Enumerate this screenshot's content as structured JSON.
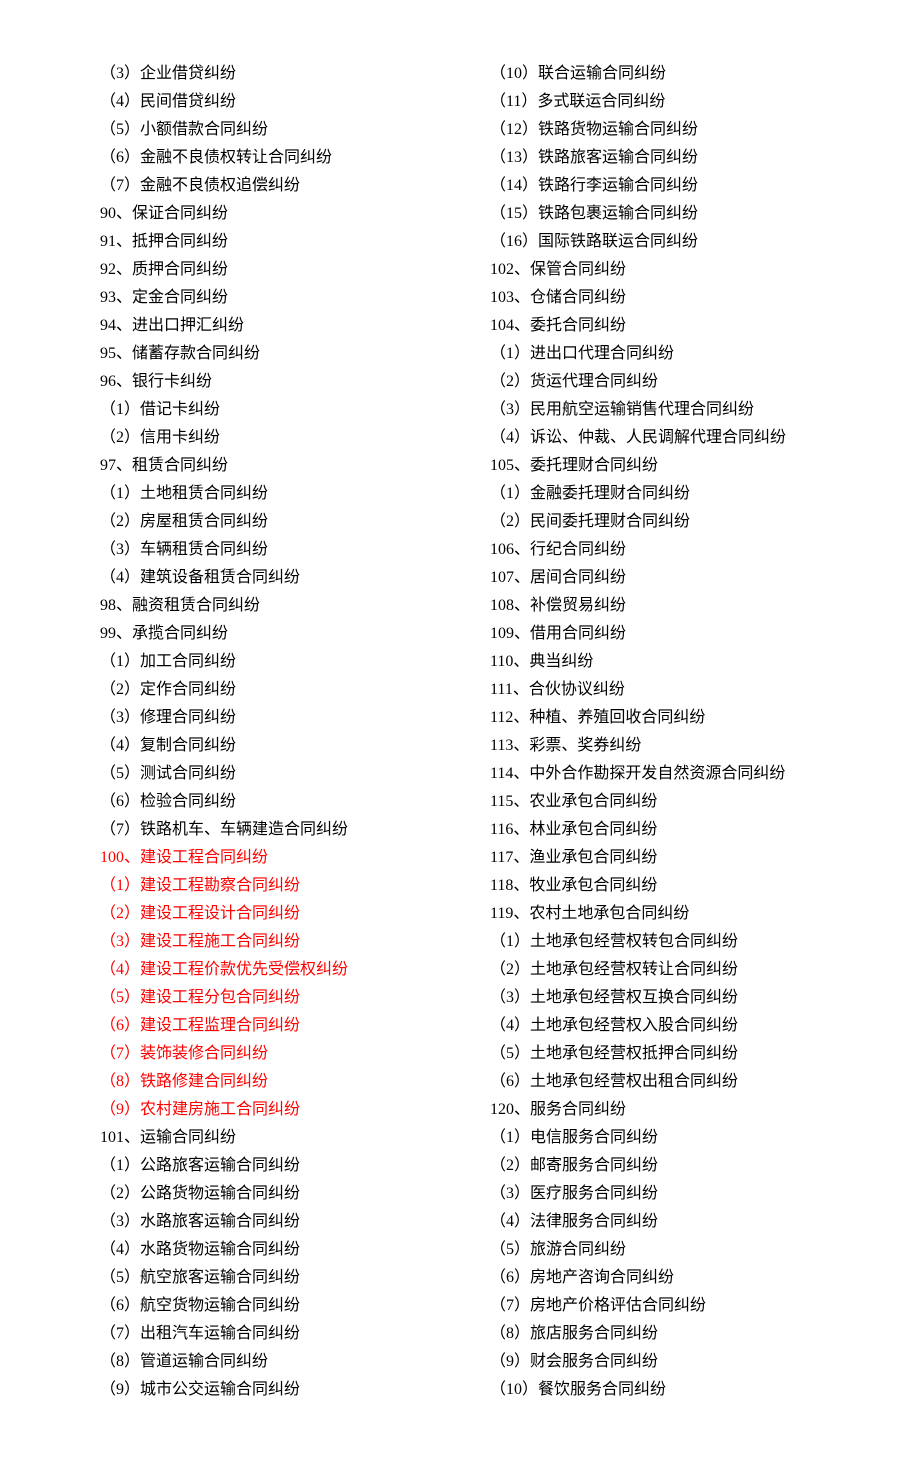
{
  "left": [
    {
      "text": "（3）企业借贷纠纷",
      "red": false
    },
    {
      "text": "（4）民间借贷纠纷",
      "red": false
    },
    {
      "text": "（5）小额借款合同纠纷",
      "red": false
    },
    {
      "text": "（6）金融不良债权转让合同纠纷",
      "red": false
    },
    {
      "text": "（7）金融不良债权追偿纠纷",
      "red": false
    },
    {
      "text": "90、保证合同纠纷",
      "red": false
    },
    {
      "text": "91、抵押合同纠纷",
      "red": false
    },
    {
      "text": "92、质押合同纠纷",
      "red": false
    },
    {
      "text": "93、定金合同纠纷",
      "red": false
    },
    {
      "text": "94、进出口押汇纠纷",
      "red": false
    },
    {
      "text": "95、储蓄存款合同纠纷",
      "red": false
    },
    {
      "text": "96、银行卡纠纷",
      "red": false
    },
    {
      "text": "（1）借记卡纠纷",
      "red": false
    },
    {
      "text": "（2）信用卡纠纷",
      "red": false
    },
    {
      "text": "97、租赁合同纠纷",
      "red": false
    },
    {
      "text": "（1）土地租赁合同纠纷",
      "red": false
    },
    {
      "text": "（2）房屋租赁合同纠纷",
      "red": false
    },
    {
      "text": "（3）车辆租赁合同纠纷",
      "red": false
    },
    {
      "text": "（4）建筑设备租赁合同纠纷",
      "red": false
    },
    {
      "text": "98、融资租赁合同纠纷",
      "red": false
    },
    {
      "text": "99、承揽合同纠纷",
      "red": false
    },
    {
      "text": "（1）加工合同纠纷",
      "red": false
    },
    {
      "text": "（2）定作合同纠纷",
      "red": false
    },
    {
      "text": "（3）修理合同纠纷",
      "red": false
    },
    {
      "text": "（4）复制合同纠纷",
      "red": false
    },
    {
      "text": "（5）测试合同纠纷",
      "red": false
    },
    {
      "text": "（6）检验合同纠纷",
      "red": false
    },
    {
      "text": "（7）铁路机车、车辆建造合同纠纷",
      "red": false
    },
    {
      "text": "100、建设工程合同纠纷",
      "red": true
    },
    {
      "text": "（1）建设工程勘察合同纠纷",
      "red": true
    },
    {
      "text": "（2）建设工程设计合同纠纷",
      "red": true
    },
    {
      "text": "（3）建设工程施工合同纠纷",
      "red": true
    },
    {
      "text": "（4）建设工程价款优先受偿权纠纷",
      "red": true
    },
    {
      "text": "（5）建设工程分包合同纠纷",
      "red": true
    },
    {
      "text": "（6）建设工程监理合同纠纷",
      "red": true
    },
    {
      "text": "（7）装饰装修合同纠纷",
      "red": true
    },
    {
      "text": "（8）铁路修建合同纠纷",
      "red": true
    },
    {
      "text": "（9）农村建房施工合同纠纷",
      "red": true
    },
    {
      "text": "101、运输合同纠纷",
      "red": false
    },
    {
      "text": "（1）公路旅客运输合同纠纷",
      "red": false
    },
    {
      "text": "（2）公路货物运输合同纠纷",
      "red": false
    },
    {
      "text": "（3）水路旅客运输合同纠纷",
      "red": false
    },
    {
      "text": "（4）水路货物运输合同纠纷",
      "red": false
    },
    {
      "text": "（5）航空旅客运输合同纠纷",
      "red": false
    },
    {
      "text": "（6）航空货物运输合同纠纷",
      "red": false
    },
    {
      "text": "（7）出租汽车运输合同纠纷",
      "red": false
    },
    {
      "text": "（8）管道运输合同纠纷",
      "red": false
    },
    {
      "text": "（9）城市公交运输合同纠纷",
      "red": false
    }
  ],
  "right": [
    {
      "text": "（10）联合运输合同纠纷",
      "red": false
    },
    {
      "text": "（11）多式联运合同纠纷",
      "red": false
    },
    {
      "text": "（12）铁路货物运输合同纠纷",
      "red": false
    },
    {
      "text": "（13）铁路旅客运输合同纠纷",
      "red": false
    },
    {
      "text": "（14）铁路行李运输合同纠纷",
      "red": false
    },
    {
      "text": "（15）铁路包裹运输合同纠纷",
      "red": false
    },
    {
      "text": "（16）国际铁路联运合同纠纷",
      "red": false
    },
    {
      "text": "102、保管合同纠纷",
      "red": false
    },
    {
      "text": "103、仓储合同纠纷",
      "red": false
    },
    {
      "text": "104、委托合同纠纷",
      "red": false
    },
    {
      "text": "（1）进出口代理合同纠纷",
      "red": false
    },
    {
      "text": "（2）货运代理合同纠纷",
      "red": false
    },
    {
      "text": "（3）民用航空运输销售代理合同纠纷",
      "red": false
    },
    {
      "text": "（4）诉讼、仲裁、人民调解代理合同纠纷",
      "red": false
    },
    {
      "text": "105、委托理财合同纠纷",
      "red": false
    },
    {
      "text": "（1）金融委托理财合同纠纷",
      "red": false
    },
    {
      "text": "（2）民间委托理财合同纠纷",
      "red": false
    },
    {
      "text": "106、行纪合同纠纷",
      "red": false
    },
    {
      "text": "107、居间合同纠纷",
      "red": false
    },
    {
      "text": "108、补偿贸易纠纷",
      "red": false
    },
    {
      "text": "109、借用合同纠纷",
      "red": false
    },
    {
      "text": "110、典当纠纷",
      "red": false
    },
    {
      "text": "111、合伙协议纠纷",
      "red": false
    },
    {
      "text": "112、种植、养殖回收合同纠纷",
      "red": false
    },
    {
      "text": "113、彩票、奖券纠纷",
      "red": false
    },
    {
      "text": "114、中外合作勘探开发自然资源合同纠纷",
      "red": false
    },
    {
      "text": "115、农业承包合同纠纷",
      "red": false
    },
    {
      "text": "116、林业承包合同纠纷",
      "red": false
    },
    {
      "text": "117、渔业承包合同纠纷",
      "red": false
    },
    {
      "text": "118、牧业承包合同纠纷",
      "red": false
    },
    {
      "text": "119、农村土地承包合同纠纷",
      "red": false
    },
    {
      "text": "（1）土地承包经营权转包合同纠纷",
      "red": false
    },
    {
      "text": "（2）土地承包经营权转让合同纠纷",
      "red": false
    },
    {
      "text": "（3）土地承包经营权互换合同纠纷",
      "red": false
    },
    {
      "text": "（4）土地承包经营权入股合同纠纷",
      "red": false
    },
    {
      "text": "（5）土地承包经营权抵押合同纠纷",
      "red": false
    },
    {
      "text": "（6）土地承包经营权出租合同纠纷",
      "red": false
    },
    {
      "text": "120、服务合同纠纷",
      "red": false
    },
    {
      "text": "（1）电信服务合同纠纷",
      "red": false
    },
    {
      "text": "（2）邮寄服务合同纠纷",
      "red": false
    },
    {
      "text": "（3）医疗服务合同纠纷",
      "red": false
    },
    {
      "text": "（4）法律服务合同纠纷",
      "red": false
    },
    {
      "text": "（5）旅游合同纠纷",
      "red": false
    },
    {
      "text": "（6）房地产咨询合同纠纷",
      "red": false
    },
    {
      "text": "（7）房地产价格评估合同纠纷",
      "red": false
    },
    {
      "text": "（8）旅店服务合同纠纷",
      "red": false
    },
    {
      "text": "（9）财会服务合同纠纷",
      "red": false
    },
    {
      "text": "（10）餐饮服务合同纠纷",
      "red": false
    }
  ]
}
